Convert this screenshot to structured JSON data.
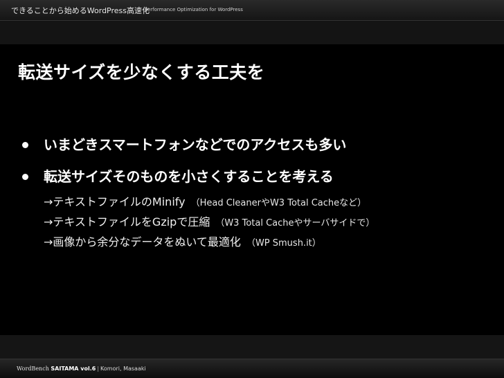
{
  "header": {
    "title": "できることから始めるWordPress高速化",
    "subtitle": "Performance Optimization for WordPress"
  },
  "slide": {
    "title": "転送サイズを少なくする工夫を",
    "bullets": [
      {
        "text": "いまどきスマートフォンなどでのアクセスも多い",
        "subitems": []
      },
      {
        "text": "転送サイズそのものを小さくすることを考える",
        "subitems": [
          {
            "text": "→テキストファイルのMinify",
            "note": "（Head CleanerやW3 Total Cacheなど）"
          },
          {
            "text": "→テキストファイルをGzipで圧縮",
            "note": "（W3 Total Cacheやサーバサイドで）"
          },
          {
            "text": "→画像から余分なデータをぬいて最適化",
            "note": "（WP Smush.it）"
          }
        ]
      }
    ]
  },
  "footer": {
    "brand": "WordBench",
    "event": "SAITAMA vol.6",
    "separator": "|",
    "author": "Komori, Masaaki"
  }
}
